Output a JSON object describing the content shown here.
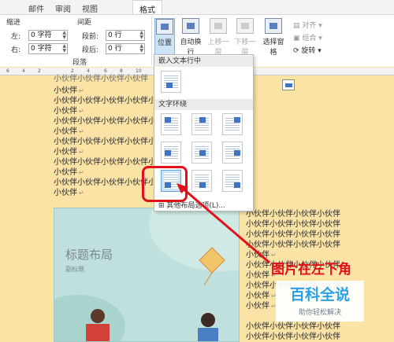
{
  "tabs": {
    "mail": "邮件",
    "review": "审阅",
    "view": "视图",
    "format": "格式"
  },
  "paragraph_group": {
    "indent_label": "缩进",
    "spacing_label": "间距",
    "left_label": "左:",
    "right_label": "右:",
    "before_label": "段前:",
    "after_label": "段后:",
    "left_value": "0 字符",
    "right_value": "0 字符",
    "before_value": "0 行",
    "after_value": "0 行",
    "title": "段落"
  },
  "arrange_group": {
    "position": "位置",
    "wrap_text": "自动换行",
    "bring_forward": "上移一层",
    "send_backward": "下移一层",
    "selection_pane": "选择窗格",
    "align": "对齐",
    "group": "组合",
    "rotate": "旋转"
  },
  "ruler": [
    "6",
    "4",
    "2",
    "2",
    "4",
    "6",
    "8",
    "10"
  ],
  "dropdown": {
    "inline_header": "嵌入文本行中",
    "wrap_header": "文字环绕",
    "more_options": "其他布局选项(L)..."
  },
  "doc": {
    "top_fragment": "小伙伴小伙伴小伙伴小伙伴",
    "left_lines": [
      "小伙伴",
      "小伙伴小伙伴小伙伴小伙伴小伙伴小伙伴小伙伴",
      "小伙伴",
      "小伙伴小伙伴小伙伴小伙伴小伙伴小伙伴小伙伴",
      "小伙伴",
      "小伙伴小伙伴小伙伴小伙伴小伙伴小伙伴小伙伴",
      "小伙伴",
      "小伙伴小伙伴小伙伴小伙伴小伙伴小伙伴小伙伴",
      "小伙伴",
      "小伙伴小伙伴小伙伴小伙伴小伙伴小伙伴小伙伴",
      "小伙伴"
    ],
    "right_lines": [
      "小伙伴小伙伴小伙伴小伙伴",
      "小伙伴小伙伴小伙伴小伙伴",
      "小伙伴小伙伴小伙伴小伙伴",
      "小伙伴小伙伴小伙伴小伙伴",
      "小伙伴",
      "小伙伴小伙伴小伙伴小伙伴",
      "小伙伴",
      "小伙伴小伙伴小伙伴小伙伴",
      "小伙伴",
      "小伙伴",
      "小伙伴小伙伴小伙伴小伙伴",
      "小伙伴小伙伴小伙伴小伙伴"
    ]
  },
  "image": {
    "title": "标题布局",
    "subtitle": "副标题"
  },
  "annotation": "图片在左下角",
  "watermark": {
    "main": "百科全说",
    "sub": "助你轻松解决"
  },
  "colors": {
    "accent": "#e2101a",
    "page": "#fbe3a6",
    "watermark": "#2aa0e6"
  }
}
